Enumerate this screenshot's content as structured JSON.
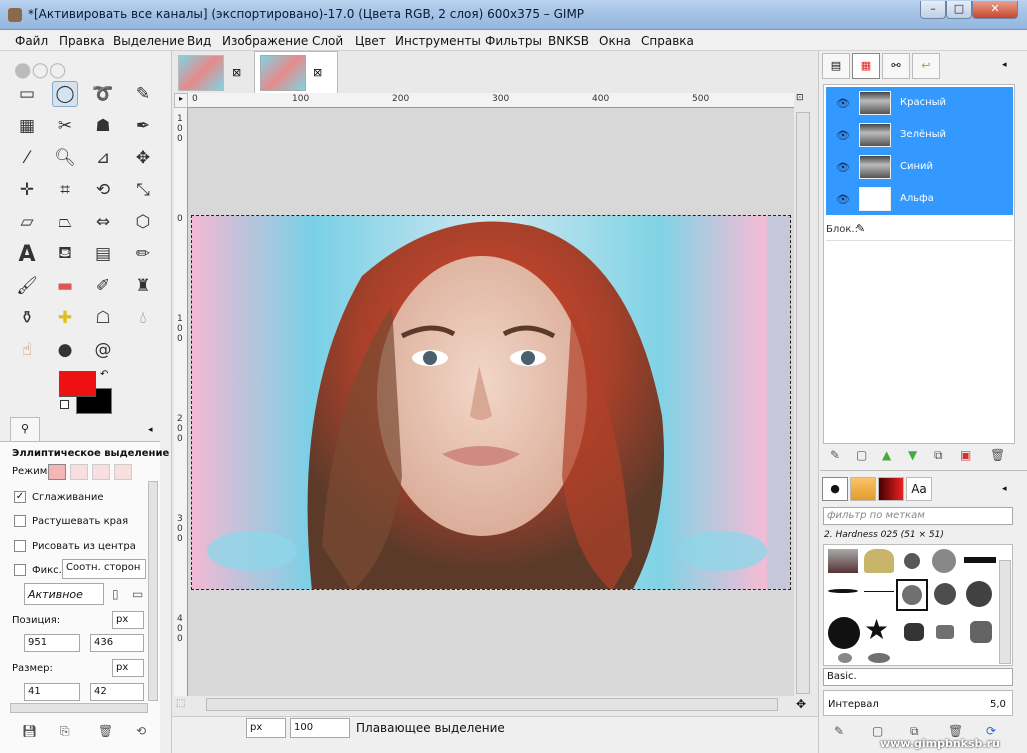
{
  "window": {
    "title": "*[Активировать все каналы] (экспортировано)-17.0 (Цвета RGB, 2 слоя) 600x375 – GIMP",
    "minimize": "–",
    "maximize": "□",
    "close": "✕"
  },
  "menu": [
    "Файл",
    "Правка",
    "Выделение",
    "Вид",
    "Изображение",
    "Слой",
    "Цвет",
    "Инструменты",
    "Фильтры",
    "BNKSB",
    "Окна",
    "Справка"
  ],
  "tabs": {
    "close_glyph": "⊠"
  },
  "ruler_top": [
    "0",
    "100",
    "200",
    "300",
    "400",
    "500"
  ],
  "ruler_left": [
    "1",
    "0",
    "0",
    "0",
    "1",
    "0",
    "0",
    "2",
    "0",
    "0",
    "3",
    "0",
    "0",
    "4",
    "0",
    "0"
  ],
  "tool_options": {
    "title": "Эллиптическое выделение",
    "mode_label": "Режим:",
    "antialias_label": "Сглаживание",
    "feather_label": "Растушевать края",
    "from_center_label": "Рисовать из центра",
    "fixed_label": "Фикс.:",
    "fixed_value": "Соотн. сторон",
    "active_value": "Активное",
    "position_label": "Позиция:",
    "position_unit": "px",
    "position_x": "951",
    "position_y": "436",
    "size_label": "Размер:",
    "size_unit": "px",
    "size_w": "41",
    "size_h": "42"
  },
  "status": {
    "unit": "px",
    "zoom": "100",
    "message": "Плавающее выделение"
  },
  "layers": {
    "rows": [
      "Красный",
      "Зелёный",
      "Синий",
      "Альфа"
    ],
    "lock_label": "Блок.:"
  },
  "brushes": {
    "filter_placeholder": "фильтр по меткам",
    "brush_name": "2. Hardness 025 (51 × 51)",
    "preset": "Basic.",
    "interval_label": "Интервал",
    "interval_value": "5,0"
  },
  "watermark": "www.gimpbnksb.ru",
  "colors": {
    "foreground": "#ee1111",
    "background": "#000000",
    "selection": "#3399ff"
  }
}
